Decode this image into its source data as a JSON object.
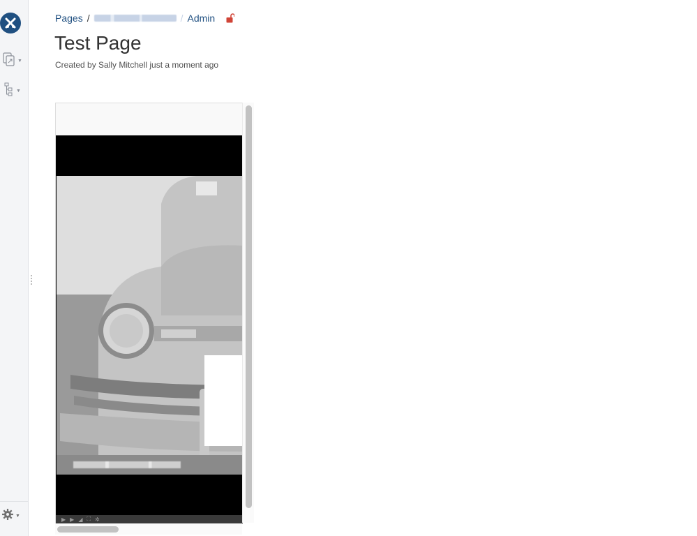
{
  "sidebar": {
    "logo_icon": "confluence-x-icon",
    "items": [
      {
        "name": "pages-icon"
      },
      {
        "name": "tree-icon"
      }
    ],
    "settings_icon": "gear-icon"
  },
  "breadcrumb": {
    "pages_label": "Pages",
    "sep": "/",
    "space_label": "",
    "sep2": "/",
    "admin_label": "Admin"
  },
  "page": {
    "title": "Test Page",
    "byline": "Created by Sally Mitchell just a moment ago"
  },
  "colors": {
    "link": "#205081",
    "lock": "#d04437",
    "sidebar": "#f4f5f7"
  }
}
